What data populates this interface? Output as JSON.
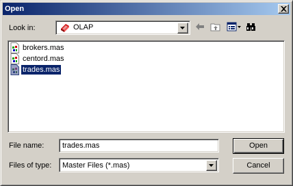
{
  "window": {
    "title": "Open"
  },
  "look_in": {
    "label": "Look in:",
    "value": "OLAP",
    "icon": "olap-folder-icon"
  },
  "toolbar": {
    "back_icon": "back-arrow-icon",
    "up_icon": "up-one-level-icon",
    "view_icon": "view-menu-icon",
    "tools_icon": "binoculars-icon"
  },
  "files": [
    {
      "name": "brokers.mas",
      "selected": false
    },
    {
      "name": "centord.mas",
      "selected": false
    },
    {
      "name": "trades.mas",
      "selected": true
    }
  ],
  "file_name": {
    "label": "File name:",
    "value": "trades.mas"
  },
  "file_type": {
    "label": "Files of type:",
    "value": "Master Files (*.mas)"
  },
  "buttons": {
    "open": "Open",
    "cancel": "Cancel"
  },
  "colors": {
    "title_start": "#0a246a",
    "title_end": "#a6caf0",
    "selection": "#0a246a",
    "face": "#d4d0c8"
  }
}
